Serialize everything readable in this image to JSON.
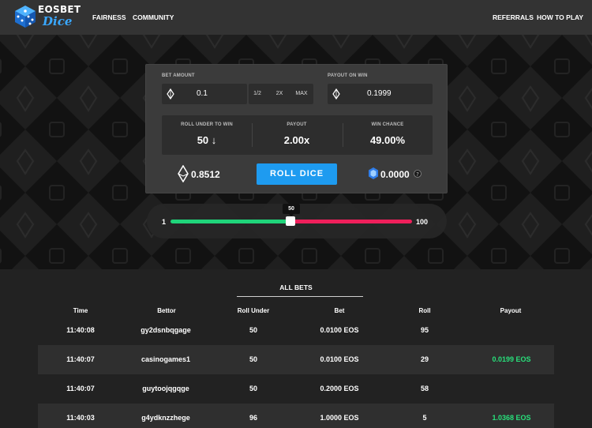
{
  "nav": {
    "brand_top": "EOSBET",
    "brand_bottom": "Dice",
    "links_left": [
      "FAIRNESS",
      "COMMUNITY"
    ],
    "links_right": [
      "REFERRALS",
      "HOW TO PLAY"
    ]
  },
  "panel": {
    "bet_amount_label": "BET AMOUNT",
    "bet_amount_value": "0.1",
    "bet_buttons": [
      "1/2",
      "2X",
      "MAX"
    ],
    "payout_label": "PAYOUT ON WIN",
    "payout_value": "0.1999",
    "stats": [
      {
        "label": "ROLL UNDER TO WIN",
        "value": "50 ↓"
      },
      {
        "label": "PAYOUT",
        "value": "2.00x"
      },
      {
        "label": "WIN CHANCE",
        "value": "49.00%"
      }
    ],
    "eos_balance": "0.8512",
    "roll_button": "ROLL DICE",
    "token_balance": "0.0000",
    "help_icon": "question-icon"
  },
  "slider": {
    "min_label": "1",
    "max_label": "100",
    "tooltip": "50",
    "value_fraction": 0.5
  },
  "bets": {
    "title": "ALL BETS",
    "columns": [
      "Time",
      "Bettor",
      "Roll Under",
      "Bet",
      "Roll",
      "Payout"
    ],
    "rows": [
      [
        "11:40:08",
        "gy2dsnbqgage",
        "50",
        "0.0100 EOS",
        "95",
        ""
      ],
      [
        "11:40:07",
        "casinogames1",
        "50",
        "0.0100 EOS",
        "29",
        "0.0199 EOS"
      ],
      [
        "11:40:07",
        "guytoojqgqge",
        "50",
        "0.2000 EOS",
        "58",
        ""
      ],
      [
        "11:40:03",
        "g4ydknzzhege",
        "96",
        "1.0000 EOS",
        "5",
        "1.0368 EOS"
      ]
    ]
  },
  "colors": {
    "accent": "#1e9bf0",
    "win_green": "#28e07b",
    "slider_green": "#1fd47a",
    "slider_red": "#ef1f5b"
  }
}
